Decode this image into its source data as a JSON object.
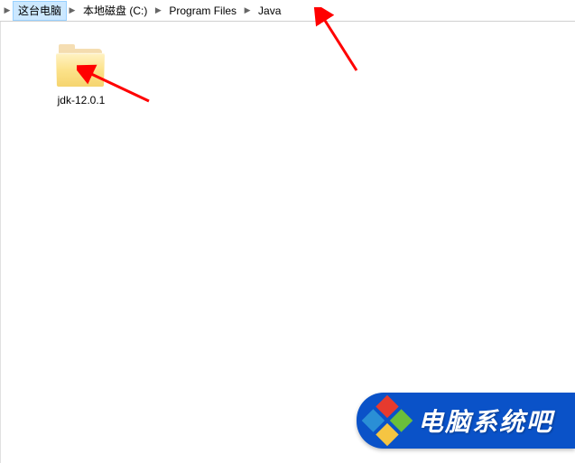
{
  "breadcrumb": {
    "items": [
      {
        "label": "这台电脑",
        "selected": true
      },
      {
        "label": "本地磁盘 (C:)",
        "selected": false
      },
      {
        "label": "Program Files",
        "selected": false
      },
      {
        "label": "Java",
        "selected": false
      }
    ]
  },
  "content": {
    "folders": [
      {
        "name": "jdk-12.0.1"
      }
    ]
  },
  "watermark": {
    "text": "电脑系统吧"
  }
}
